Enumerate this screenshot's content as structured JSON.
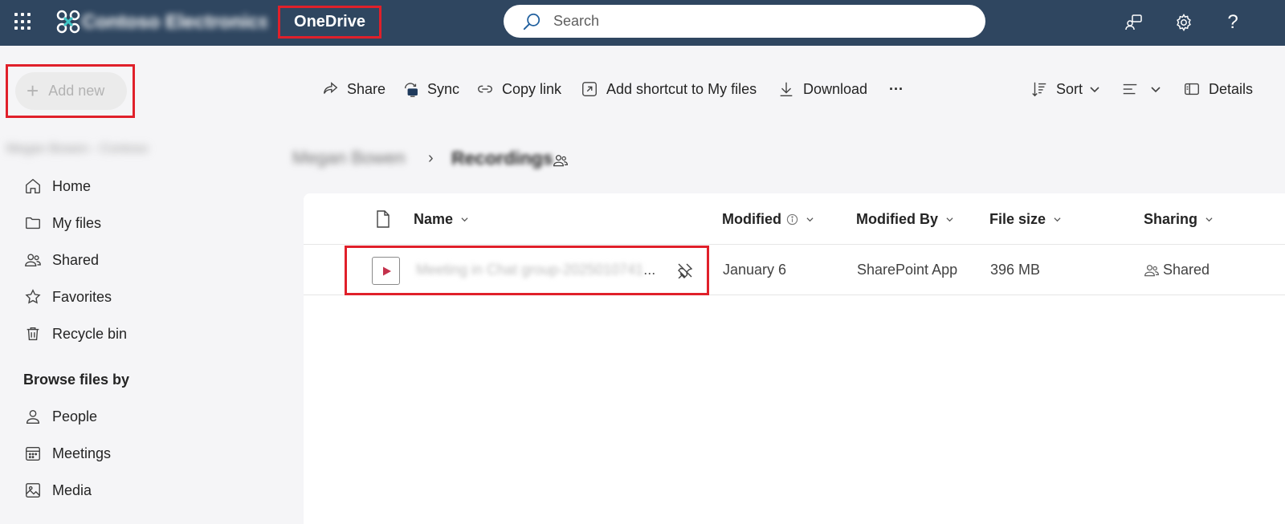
{
  "header": {
    "org_name": "Contoso Electronics",
    "app_title": "OneDrive",
    "search_placeholder": "Search"
  },
  "sidebar": {
    "add_new_label": "Add new",
    "user_name": "Megan Bowen - Contoso",
    "nav_items": [
      {
        "label": "Home",
        "icon": "home-icon"
      },
      {
        "label": "My files",
        "icon": "folder-icon"
      },
      {
        "label": "Shared",
        "icon": "people-icon"
      },
      {
        "label": "Favorites",
        "icon": "star-icon"
      },
      {
        "label": "Recycle bin",
        "icon": "trash-icon"
      }
    ],
    "browse_title": "Browse files by",
    "browse_items": [
      {
        "label": "People",
        "icon": "person-icon"
      },
      {
        "label": "Meetings",
        "icon": "calendar-icon"
      },
      {
        "label": "Media",
        "icon": "image-icon"
      }
    ]
  },
  "toolbar": {
    "share": "Share",
    "sync": "Sync",
    "copy_link": "Copy link",
    "add_shortcut": "Add shortcut to My files",
    "download": "Download",
    "more": "···",
    "sort": "Sort",
    "details": "Details"
  },
  "breadcrumb": {
    "parent": "Megan Bowen",
    "current_blurred": "Recordings",
    "current": "Recordings"
  },
  "table": {
    "columns": {
      "name": "Name",
      "modified": "Modified",
      "modified_by": "Modified By",
      "file_size": "File size",
      "sharing": "Sharing"
    },
    "rows": [
      {
        "name_blurred": "Meeting in Chat group-2025010741",
        "name_tail": "...",
        "modified": "January 6",
        "modified_by": "SharePoint App",
        "file_size": "396 MB",
        "sharing": "Shared"
      }
    ]
  },
  "colors": {
    "topbar": "#2f4660",
    "highlight": "#e0202a",
    "video_accent": "#c4314b"
  }
}
